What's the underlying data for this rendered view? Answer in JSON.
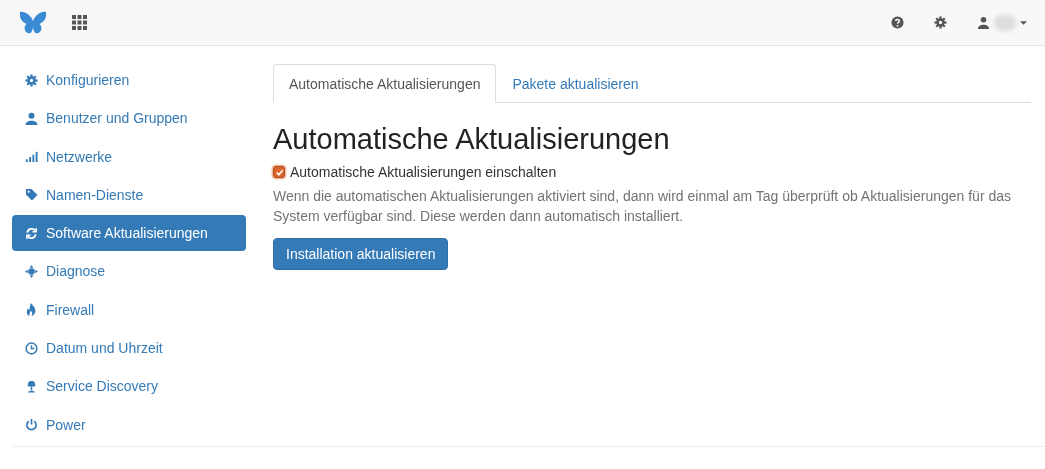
{
  "sidebar": {
    "items": [
      {
        "label": "Konfigurieren",
        "kind": "gear",
        "selected": false
      },
      {
        "label": "Benutzer und Gruppen",
        "kind": "user",
        "selected": false
      },
      {
        "label": "Netzwerke",
        "kind": "signal",
        "selected": false
      },
      {
        "label": "Namen-Dienste",
        "kind": "tag",
        "selected": false
      },
      {
        "label": "Software Aktualisierungen",
        "kind": "refresh",
        "selected": true
      },
      {
        "label": "Diagnose",
        "kind": "crosshair",
        "selected": false
      },
      {
        "label": "Firewall",
        "kind": "fire",
        "selected": false
      },
      {
        "label": "Datum und Uhrzeit",
        "kind": "clock",
        "selected": false
      },
      {
        "label": "Service Discovery",
        "kind": "lamp",
        "selected": false
      },
      {
        "label": "Power",
        "kind": "power",
        "selected": false
      }
    ]
  },
  "tabs": [
    {
      "label": "Automatische Aktualisierungen",
      "selected": true
    },
    {
      "label": "Pakete aktualisieren",
      "selected": false
    }
  ],
  "heading": "Automatische Aktualisierungen",
  "checkbox": {
    "label": "Automatische Aktualisierungen einschalten",
    "checked": true
  },
  "description": "Wenn die automatischen Aktualisierungen aktiviert sind, dann wird einmal am Tag überprüft ob Aktualisierungen für das System verfügbar sind. Diese werden dann automatisch installiert.",
  "button": "Installation aktualisieren"
}
